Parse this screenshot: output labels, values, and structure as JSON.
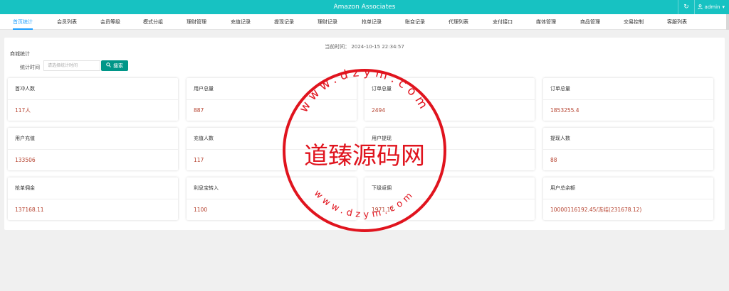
{
  "header": {
    "title": "Amazon Associates",
    "user": "admin"
  },
  "nav": {
    "tabs": [
      "首页统计",
      "会员列表",
      "会员等级",
      "模式分组",
      "理财管理",
      "充值记录",
      "提现记录",
      "理财记录",
      "抢单记录",
      "账变记录",
      "代理列表",
      "支付接口",
      "媒体管理",
      "商品管理",
      "交易控制",
      "客服列表"
    ],
    "active_index": 0
  },
  "stats": {
    "current_time": "当前时间： 2024-10-15 22:34:57",
    "section_title": "商城统计",
    "filter_label": "统计时间",
    "filter_placeholder": "请选择统计时间",
    "search_label": "搜索"
  },
  "cards": [
    {
      "label": "首冲人数",
      "value": "117人"
    },
    {
      "label": "用户总量",
      "value": "887"
    },
    {
      "label": "订单总量",
      "value": "2494"
    },
    {
      "label": "订单总量",
      "value": "1853255.4"
    },
    {
      "label": "用户充值",
      "value": "133506"
    },
    {
      "label": "充值人数",
      "value": "117"
    },
    {
      "label": "用户提现",
      "value": ""
    },
    {
      "label": "提现人数",
      "value": "88"
    },
    {
      "label": "抢单佣金",
      "value": "137168.11"
    },
    {
      "label": "利息宝转入",
      "value": "1100"
    },
    {
      "label": "下级返佣",
      "value": "1971.17"
    },
    {
      "label": "用户总余额",
      "value": "10000116192.45/冻结(231678.12)"
    }
  ],
  "watermark": {
    "main_text": "道臻源码网",
    "ring_top": "www.dzym.com",
    "ring_bottom": "www.dzym.com",
    "color": "#e0141e"
  },
  "colors": {
    "brand": "#17c2c2",
    "accent": "#1e9fff",
    "button": "#009688",
    "value": "#b5412e"
  }
}
